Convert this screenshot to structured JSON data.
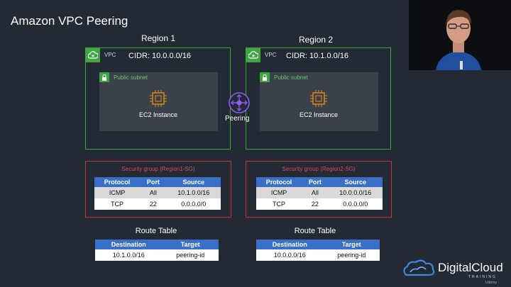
{
  "title": "Amazon VPC Peering",
  "regions": [
    {
      "label": "Region 1",
      "vpc_tag": "VPC",
      "cidr": "CIDR: 10.0.0.0/16",
      "subnet_label": "Public subnet",
      "instance_label": "EC2 Instance",
      "sg_title": "Security group  (Region1-SG)",
      "sg_headers": [
        "Protocol",
        "Port",
        "Source"
      ],
      "sg_rows": [
        [
          "ICMP",
          "All",
          "10.1.0.0/16"
        ],
        [
          "TCP",
          "22",
          "0.0.0.0/0"
        ]
      ],
      "rt_title": "Route Table",
      "rt_headers": [
        "Destination",
        "Target"
      ],
      "rt_rows": [
        [
          "10.1.0.0/16",
          "peering-id"
        ]
      ]
    },
    {
      "label": "Region 2",
      "vpc_tag": "VPC",
      "cidr": "CIDR: 10.1.0.0/16",
      "subnet_label": "Public subnet",
      "instance_label": "EC2 Instance",
      "sg_title": "Security group (Region2-SG)",
      "sg_headers": [
        "Protocol",
        "Port",
        "Source"
      ],
      "sg_rows": [
        [
          "ICMP",
          "All",
          "10.0.0.0/16"
        ],
        [
          "TCP",
          "22",
          "0.0.0.0/0"
        ]
      ],
      "rt_title": "Route Table",
      "rt_headers": [
        "Destination",
        "Target"
      ],
      "rt_rows": [
        [
          "10.0.0.0/16",
          "peering-id"
        ]
      ]
    }
  ],
  "peering_label": "Peering",
  "logo": {
    "name": "DigitalCloud",
    "sub": "TRAINING",
    "watermark": "Udemy"
  },
  "colors": {
    "background": "#232a33",
    "vpc_border": "#3fa642",
    "security_group": "#c2343c",
    "table_header": "#3a6fc7",
    "ec2_orange": "#e8891d",
    "peering_purple": "#8b5cf6"
  }
}
